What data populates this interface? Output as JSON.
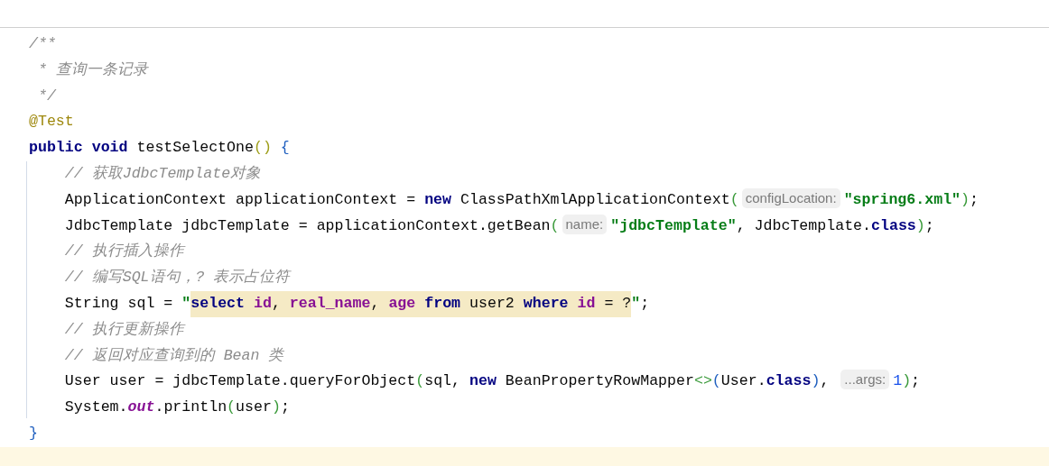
{
  "editor": {
    "lines": [
      {
        "current": false,
        "tokens": [
          {
            "kind": "comment",
            "text": "/**"
          }
        ]
      },
      {
        "current": false,
        "tokens": [
          {
            "kind": "comment",
            "text": " * 查询一条记录"
          }
        ]
      },
      {
        "current": false,
        "tokens": [
          {
            "kind": "comment",
            "text": " */"
          }
        ]
      },
      {
        "current": false,
        "tokens": [
          {
            "kind": "annotation",
            "text": "@Test"
          }
        ]
      },
      {
        "current": false,
        "tokens": [
          {
            "kind": "keyword",
            "text": "public void "
          },
          {
            "kind": "plain",
            "text": "testSelectOne"
          },
          {
            "kind": "bracket",
            "color": "#9e9e1a",
            "text": "() "
          },
          {
            "kind": "bracket",
            "color": "#1f5fbf",
            "text": "{"
          }
        ]
      },
      {
        "current": false,
        "tokens": [
          {
            "kind": "comment",
            "text": "    // 获取JdbcTemplate对象"
          }
        ]
      },
      {
        "current": false,
        "tokens": [
          {
            "kind": "plain",
            "text": "    ApplicationContext applicationContext = "
          },
          {
            "kind": "keyword",
            "text": "new "
          },
          {
            "kind": "plain",
            "text": "ClassPathXmlApplicationContext"
          },
          {
            "kind": "bracket",
            "color": "#3a9a3a",
            "text": "("
          },
          {
            "kind": "hint",
            "text": "configLocation:"
          },
          {
            "kind": "string",
            "text": "\"spring6.xml\""
          },
          {
            "kind": "bracket",
            "color": "#3a9a3a",
            "text": ")"
          },
          {
            "kind": "plain",
            "text": ";"
          }
        ]
      },
      {
        "current": false,
        "tokens": [
          {
            "kind": "plain",
            "text": "    JdbcTemplate jdbcTemplate = applicationContext.getBean"
          },
          {
            "kind": "bracket",
            "color": "#3a9a3a",
            "text": "("
          },
          {
            "kind": "hint",
            "text": "name:"
          },
          {
            "kind": "string",
            "text": "\"jdbcTemplate\""
          },
          {
            "kind": "plain",
            "text": ", JdbcTemplate."
          },
          {
            "kind": "keyword",
            "text": "class"
          },
          {
            "kind": "bracket",
            "color": "#3a9a3a",
            "text": ")"
          },
          {
            "kind": "plain",
            "text": ";"
          }
        ]
      },
      {
        "current": false,
        "tokens": [
          {
            "kind": "comment",
            "text": "    // 执行插入操作"
          }
        ]
      },
      {
        "current": false,
        "tokens": [
          {
            "kind": "comment",
            "text": "    // 编写SQL语句，? 表示占位符"
          }
        ]
      },
      {
        "current": false,
        "tokens": [
          {
            "kind": "plain",
            "text": "    String sql = "
          },
          {
            "kind": "string",
            "text": "\""
          },
          {
            "kind": "sql-keyword",
            "injected": true,
            "text": "select "
          },
          {
            "kind": "sql-column",
            "injected": true,
            "text": "id"
          },
          {
            "kind": "plain",
            "injected": true,
            "text": ", "
          },
          {
            "kind": "sql-column",
            "injected": true,
            "text": "real_name"
          },
          {
            "kind": "plain",
            "injected": true,
            "text": ", "
          },
          {
            "kind": "sql-column",
            "injected": true,
            "text": "age "
          },
          {
            "kind": "sql-keyword",
            "injected": true,
            "text": "from "
          },
          {
            "kind": "plain",
            "injected": true,
            "text": "user2 "
          },
          {
            "kind": "sql-keyword",
            "injected": true,
            "text": "where "
          },
          {
            "kind": "sql-column",
            "injected": true,
            "text": "id "
          },
          {
            "kind": "plain",
            "injected": true,
            "text": "= ?"
          },
          {
            "kind": "string",
            "text": "\""
          },
          {
            "kind": "plain",
            "text": ";"
          }
        ]
      },
      {
        "current": false,
        "tokens": [
          {
            "kind": "comment",
            "text": "    // 执行更新操作"
          }
        ]
      },
      {
        "current": false,
        "tokens": [
          {
            "kind": "comment",
            "text": "    // 返回对应查询到的 Bean 类"
          }
        ]
      },
      {
        "current": false,
        "tokens": [
          {
            "kind": "plain",
            "text": "    User user = jdbcTemplate.queryForObject"
          },
          {
            "kind": "bracket",
            "color": "#3a9a3a",
            "text": "("
          },
          {
            "kind": "plain",
            "text": "sql, "
          },
          {
            "kind": "keyword",
            "text": "new "
          },
          {
            "kind": "plain",
            "text": "BeanPropertyRowMapper"
          },
          {
            "kind": "bracket",
            "color": "#3a9a3a",
            "text": "<>"
          },
          {
            "kind": "bracket",
            "color": "#1f5fbf",
            "text": "("
          },
          {
            "kind": "plain",
            "text": "User."
          },
          {
            "kind": "keyword",
            "text": "class"
          },
          {
            "kind": "bracket",
            "color": "#1f5fbf",
            "text": ")"
          },
          {
            "kind": "plain",
            "text": ", "
          },
          {
            "kind": "hint",
            "text": "...args:"
          },
          {
            "kind": "number",
            "text": "1"
          },
          {
            "kind": "bracket",
            "color": "#3a9a3a",
            "text": ")"
          },
          {
            "kind": "plain",
            "text": ";"
          }
        ]
      },
      {
        "current": false,
        "tokens": [
          {
            "kind": "plain",
            "text": "    System."
          },
          {
            "kind": "field",
            "text": "out"
          },
          {
            "kind": "plain",
            "text": ".println"
          },
          {
            "kind": "bracket",
            "color": "#3a9a3a",
            "text": "("
          },
          {
            "kind": "plain",
            "text": "user"
          },
          {
            "kind": "bracket",
            "color": "#3a9a3a",
            "text": ")"
          },
          {
            "kind": "plain",
            "text": ";"
          }
        ]
      },
      {
        "current": false,
        "tokens": [
          {
            "kind": "bracket",
            "color": "#1f5fbf",
            "text": "}"
          }
        ]
      },
      {
        "current": true
      }
    ]
  }
}
